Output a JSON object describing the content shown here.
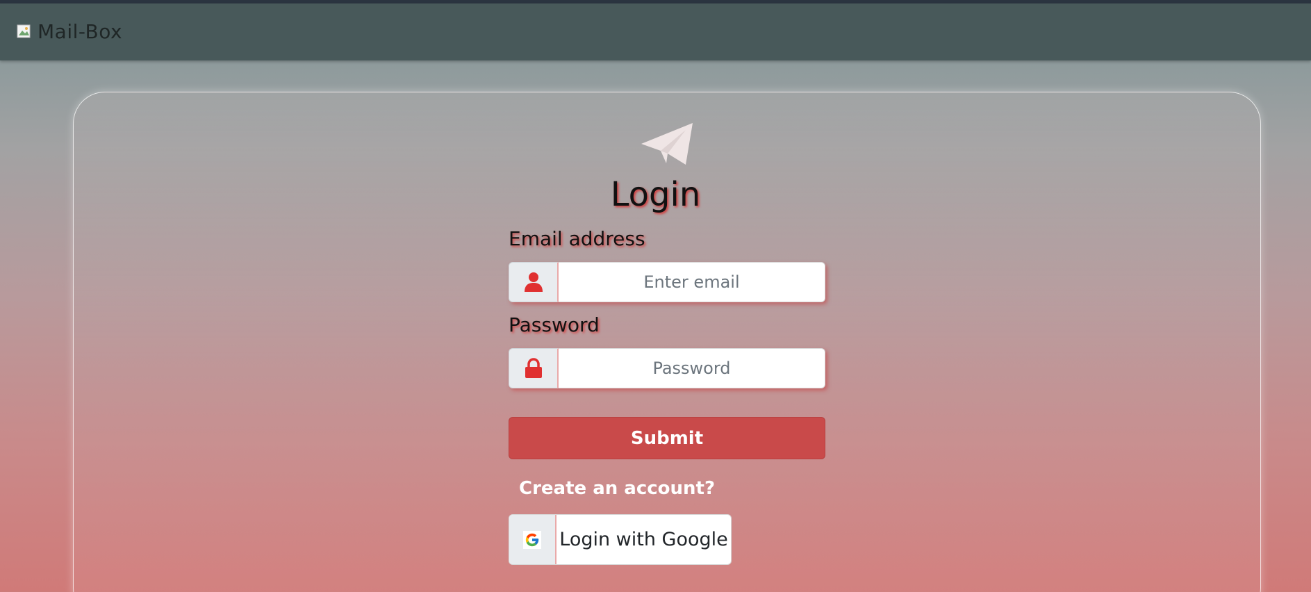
{
  "navbar": {
    "brand_text": "Mail-Box"
  },
  "login": {
    "title": "Login",
    "email_label": "Email address",
    "email_placeholder": "Enter email",
    "email_value": "",
    "password_label": "Password",
    "password_placeholder": "Password",
    "password_value": "",
    "submit_label": "Submit",
    "create_account_label": "Create an account?",
    "google_label": "Login with Google"
  },
  "icons": {
    "brand": "broken-image-icon",
    "logo": "paper-plane-icon",
    "email": "user-icon",
    "password": "lock-icon",
    "google": "google-g-icon"
  },
  "colors": {
    "navbar": "#48595a",
    "accent_red": "#c94a4a",
    "icon_red": "#e03030",
    "plane": "#efe5e5"
  }
}
